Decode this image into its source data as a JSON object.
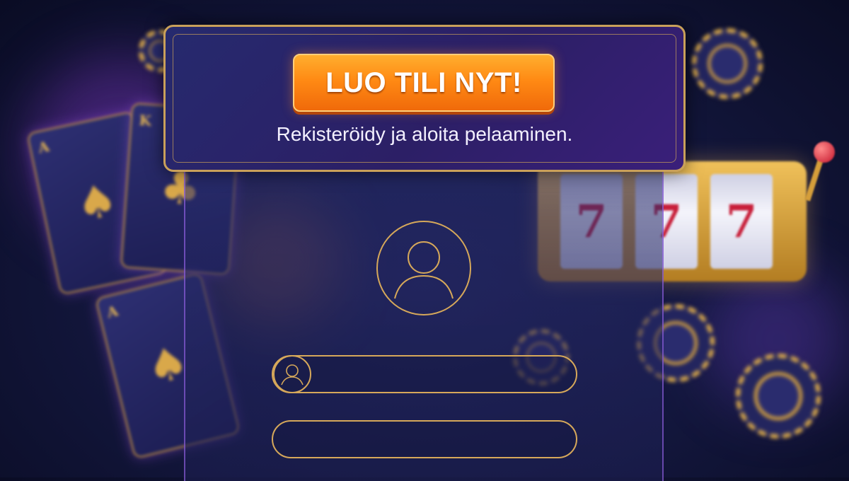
{
  "banner": {
    "cta_label": "LUO TILI NYT!",
    "subtitle": "Rekisteröidy ja aloita pelaaminen."
  },
  "decor": {
    "card_ranks": [
      "A",
      "K",
      "A"
    ],
    "card_suits": [
      "♠",
      "♣",
      "♠"
    ],
    "slot_symbols": [
      "7",
      "7",
      "7"
    ]
  },
  "form": {
    "username_placeholder": "",
    "password_placeholder": ""
  },
  "colors": {
    "cta_orange": "#ff8a14",
    "gold_border": "#d6a85a",
    "background_navy": "#141840"
  },
  "icons": [
    "user-avatar-icon",
    "user-icon"
  ]
}
